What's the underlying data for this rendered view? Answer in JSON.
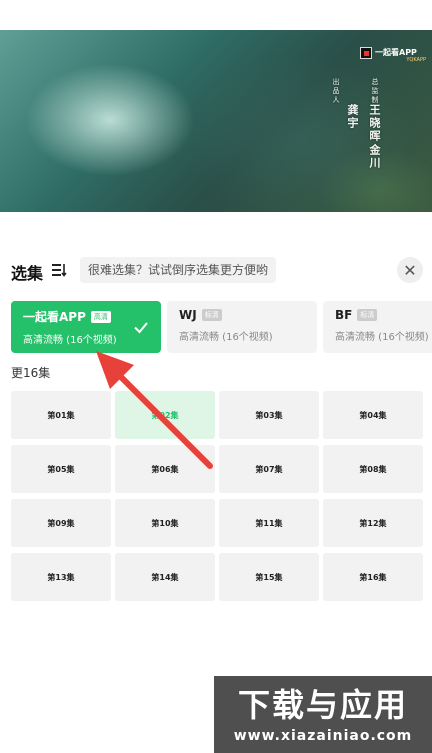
{
  "video": {
    "logo_text": "一起看APP",
    "logo_sub": "YQKAPP",
    "credits": [
      {
        "text": "出品人",
        "size": "small"
      },
      {
        "text": "龚宇",
        "size": "big"
      },
      {
        "text": "总监制",
        "size": "small"
      },
      {
        "text": "王晓晖",
        "size": "big"
      },
      {
        "text": "金川",
        "size": "big"
      }
    ]
  },
  "panel": {
    "title": "选集",
    "hint": "很难选集？试试倒序选集更方便哟",
    "close_glyph": "✕"
  },
  "sources": [
    {
      "name": "一起看APP",
      "badge": "高清",
      "desc": "高清流畅 (16个视频)",
      "active": true
    },
    {
      "name": "WJ",
      "badge": "标清",
      "desc": "高清流畅 (16个视频)",
      "active": false
    },
    {
      "name": "BF",
      "badge": "标清",
      "desc": "高清流畅 (16个视频)",
      "active": false
    }
  ],
  "episode_count": "更16集",
  "episodes": [
    "第01集",
    "第02集",
    "第03集",
    "第04集",
    "第05集",
    "第06集",
    "第07集",
    "第08集",
    "第09集",
    "第10集",
    "第11集",
    "第12集",
    "第13集",
    "第14集",
    "第15集",
    "第16集"
  ],
  "active_episode_index": 1,
  "watermark": {
    "title": "下载与应用",
    "url": "www.xiazainiao.com"
  },
  "colors": {
    "accent": "#25c06a",
    "arrow": "#e8413a"
  }
}
